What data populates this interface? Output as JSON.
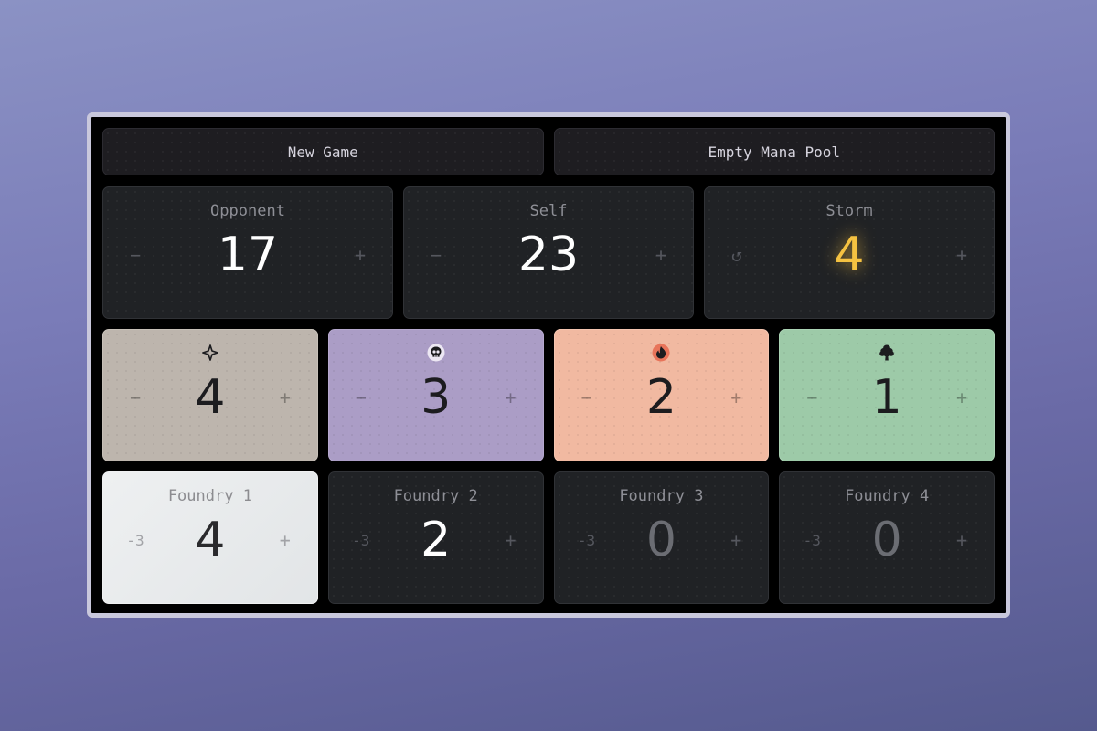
{
  "toolbar": {
    "new_game_label": "New Game",
    "empty_mana_label": "Empty Mana Pool"
  },
  "life": {
    "opponent": {
      "label": "Opponent",
      "value": "17",
      "dec": "−",
      "inc": "+"
    },
    "self": {
      "label": "Self",
      "value": "23",
      "dec": "−",
      "inc": "+"
    },
    "storm": {
      "label": "Storm",
      "value": "4",
      "reset": "↺",
      "inc": "+"
    }
  },
  "mana": [
    {
      "icon": "white-mana-icon",
      "value": "4",
      "dec": "−",
      "inc": "+",
      "color": "#bdb5ad"
    },
    {
      "icon": "black-mana-icon",
      "value": "3",
      "dec": "−",
      "inc": "+",
      "color": "#ab9dc6"
    },
    {
      "icon": "red-mana-icon",
      "value": "2",
      "dec": "−",
      "inc": "+",
      "color": "#f1b9a1"
    },
    {
      "icon": "green-mana-icon",
      "value": "1",
      "dec": "−",
      "inc": "+",
      "color": "#9dcaa8"
    }
  ],
  "foundries": [
    {
      "label": "Foundry 1",
      "value": "4",
      "dec": "-3",
      "inc": "+"
    },
    {
      "label": "Foundry 2",
      "value": "2",
      "dec": "-3",
      "inc": "+"
    },
    {
      "label": "Foundry 3",
      "value": "0",
      "dec": "-3",
      "inc": "+"
    },
    {
      "label": "Foundry 4",
      "value": "0",
      "dec": "-3",
      "inc": "+"
    }
  ],
  "colors": {
    "storm_accent": "#f5c241",
    "frame_border": "#c9c8dc"
  }
}
